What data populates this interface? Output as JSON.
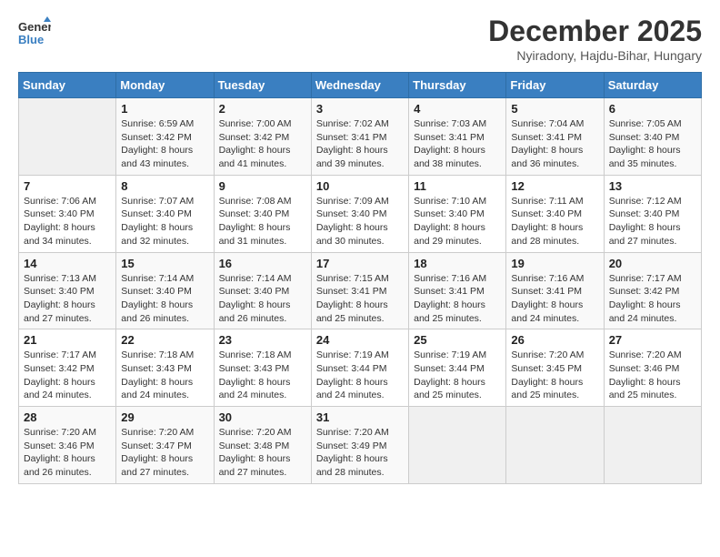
{
  "header": {
    "logo_line1": "General",
    "logo_line2": "Blue",
    "month": "December 2025",
    "location": "Nyiradony, Hajdu-Bihar, Hungary"
  },
  "weekdays": [
    "Sunday",
    "Monday",
    "Tuesday",
    "Wednesday",
    "Thursday",
    "Friday",
    "Saturday"
  ],
  "weeks": [
    [
      {
        "day": "",
        "sunrise": "",
        "sunset": "",
        "daylight": ""
      },
      {
        "day": "1",
        "sunrise": "Sunrise: 6:59 AM",
        "sunset": "Sunset: 3:42 PM",
        "daylight": "Daylight: 8 hours and 43 minutes."
      },
      {
        "day": "2",
        "sunrise": "Sunrise: 7:00 AM",
        "sunset": "Sunset: 3:42 PM",
        "daylight": "Daylight: 8 hours and 41 minutes."
      },
      {
        "day": "3",
        "sunrise": "Sunrise: 7:02 AM",
        "sunset": "Sunset: 3:41 PM",
        "daylight": "Daylight: 8 hours and 39 minutes."
      },
      {
        "day": "4",
        "sunrise": "Sunrise: 7:03 AM",
        "sunset": "Sunset: 3:41 PM",
        "daylight": "Daylight: 8 hours and 38 minutes."
      },
      {
        "day": "5",
        "sunrise": "Sunrise: 7:04 AM",
        "sunset": "Sunset: 3:41 PM",
        "daylight": "Daylight: 8 hours and 36 minutes."
      },
      {
        "day": "6",
        "sunrise": "Sunrise: 7:05 AM",
        "sunset": "Sunset: 3:40 PM",
        "daylight": "Daylight: 8 hours and 35 minutes."
      }
    ],
    [
      {
        "day": "7",
        "sunrise": "Sunrise: 7:06 AM",
        "sunset": "Sunset: 3:40 PM",
        "daylight": "Daylight: 8 hours and 34 minutes."
      },
      {
        "day": "8",
        "sunrise": "Sunrise: 7:07 AM",
        "sunset": "Sunset: 3:40 PM",
        "daylight": "Daylight: 8 hours and 32 minutes."
      },
      {
        "day": "9",
        "sunrise": "Sunrise: 7:08 AM",
        "sunset": "Sunset: 3:40 PM",
        "daylight": "Daylight: 8 hours and 31 minutes."
      },
      {
        "day": "10",
        "sunrise": "Sunrise: 7:09 AM",
        "sunset": "Sunset: 3:40 PM",
        "daylight": "Daylight: 8 hours and 30 minutes."
      },
      {
        "day": "11",
        "sunrise": "Sunrise: 7:10 AM",
        "sunset": "Sunset: 3:40 PM",
        "daylight": "Daylight: 8 hours and 29 minutes."
      },
      {
        "day": "12",
        "sunrise": "Sunrise: 7:11 AM",
        "sunset": "Sunset: 3:40 PM",
        "daylight": "Daylight: 8 hours and 28 minutes."
      },
      {
        "day": "13",
        "sunrise": "Sunrise: 7:12 AM",
        "sunset": "Sunset: 3:40 PM",
        "daylight": "Daylight: 8 hours and 27 minutes."
      }
    ],
    [
      {
        "day": "14",
        "sunrise": "Sunrise: 7:13 AM",
        "sunset": "Sunset: 3:40 PM",
        "daylight": "Daylight: 8 hours and 27 minutes."
      },
      {
        "day": "15",
        "sunrise": "Sunrise: 7:14 AM",
        "sunset": "Sunset: 3:40 PM",
        "daylight": "Daylight: 8 hours and 26 minutes."
      },
      {
        "day": "16",
        "sunrise": "Sunrise: 7:14 AM",
        "sunset": "Sunset: 3:40 PM",
        "daylight": "Daylight: 8 hours and 26 minutes."
      },
      {
        "day": "17",
        "sunrise": "Sunrise: 7:15 AM",
        "sunset": "Sunset: 3:41 PM",
        "daylight": "Daylight: 8 hours and 25 minutes."
      },
      {
        "day": "18",
        "sunrise": "Sunrise: 7:16 AM",
        "sunset": "Sunset: 3:41 PM",
        "daylight": "Daylight: 8 hours and 25 minutes."
      },
      {
        "day": "19",
        "sunrise": "Sunrise: 7:16 AM",
        "sunset": "Sunset: 3:41 PM",
        "daylight": "Daylight: 8 hours and 24 minutes."
      },
      {
        "day": "20",
        "sunrise": "Sunrise: 7:17 AM",
        "sunset": "Sunset: 3:42 PM",
        "daylight": "Daylight: 8 hours and 24 minutes."
      }
    ],
    [
      {
        "day": "21",
        "sunrise": "Sunrise: 7:17 AM",
        "sunset": "Sunset: 3:42 PM",
        "daylight": "Daylight: 8 hours and 24 minutes."
      },
      {
        "day": "22",
        "sunrise": "Sunrise: 7:18 AM",
        "sunset": "Sunset: 3:43 PM",
        "daylight": "Daylight: 8 hours and 24 minutes."
      },
      {
        "day": "23",
        "sunrise": "Sunrise: 7:18 AM",
        "sunset": "Sunset: 3:43 PM",
        "daylight": "Daylight: 8 hours and 24 minutes."
      },
      {
        "day": "24",
        "sunrise": "Sunrise: 7:19 AM",
        "sunset": "Sunset: 3:44 PM",
        "daylight": "Daylight: 8 hours and 24 minutes."
      },
      {
        "day": "25",
        "sunrise": "Sunrise: 7:19 AM",
        "sunset": "Sunset: 3:44 PM",
        "daylight": "Daylight: 8 hours and 25 minutes."
      },
      {
        "day": "26",
        "sunrise": "Sunrise: 7:20 AM",
        "sunset": "Sunset: 3:45 PM",
        "daylight": "Daylight: 8 hours and 25 minutes."
      },
      {
        "day": "27",
        "sunrise": "Sunrise: 7:20 AM",
        "sunset": "Sunset: 3:46 PM",
        "daylight": "Daylight: 8 hours and 25 minutes."
      }
    ],
    [
      {
        "day": "28",
        "sunrise": "Sunrise: 7:20 AM",
        "sunset": "Sunset: 3:46 PM",
        "daylight": "Daylight: 8 hours and 26 minutes."
      },
      {
        "day": "29",
        "sunrise": "Sunrise: 7:20 AM",
        "sunset": "Sunset: 3:47 PM",
        "daylight": "Daylight: 8 hours and 27 minutes."
      },
      {
        "day": "30",
        "sunrise": "Sunrise: 7:20 AM",
        "sunset": "Sunset: 3:48 PM",
        "daylight": "Daylight: 8 hours and 27 minutes."
      },
      {
        "day": "31",
        "sunrise": "Sunrise: 7:20 AM",
        "sunset": "Sunset: 3:49 PM",
        "daylight": "Daylight: 8 hours and 28 minutes."
      },
      {
        "day": "",
        "sunrise": "",
        "sunset": "",
        "daylight": ""
      },
      {
        "day": "",
        "sunrise": "",
        "sunset": "",
        "daylight": ""
      },
      {
        "day": "",
        "sunrise": "",
        "sunset": "",
        "daylight": ""
      }
    ]
  ]
}
